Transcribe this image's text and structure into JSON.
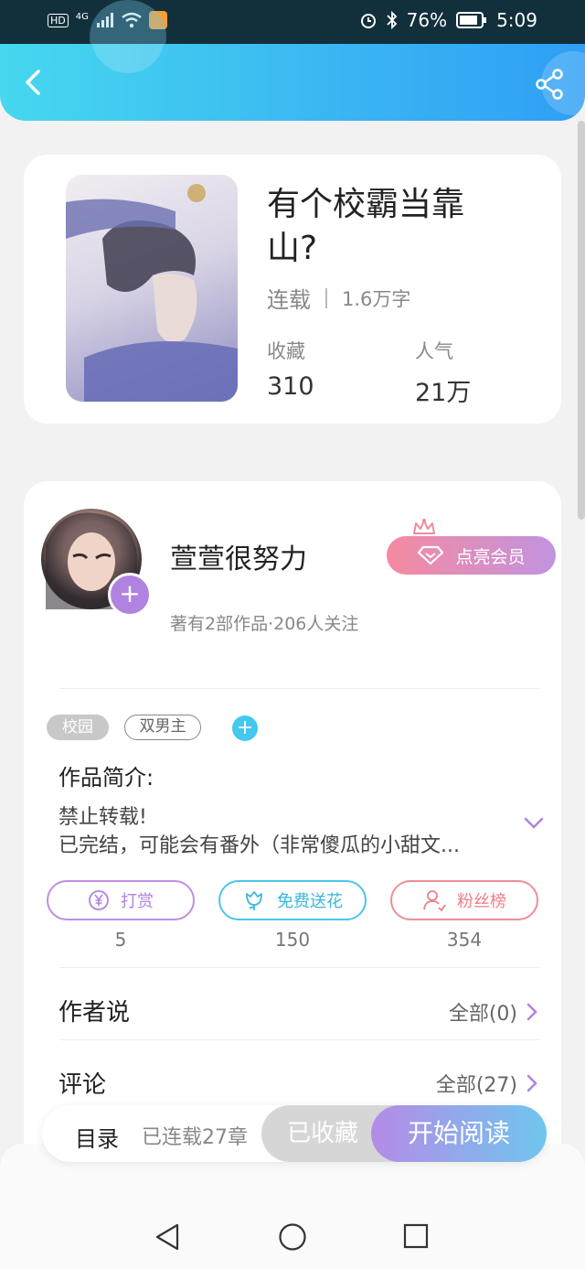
{
  "status_bar": {
    "hd": "HD",
    "signal": "4G",
    "battery": "76%",
    "time": "5:09"
  },
  "book": {
    "title": "有个校霸当靠山?",
    "status": "连载",
    "word_count": "1.6万字",
    "favorites_label": "收藏",
    "favorites_value": "310",
    "popularity_label": "人气",
    "popularity_value": "21万"
  },
  "author": {
    "name": "萱萱很努力",
    "subtitle": "著有2部作品·206人关注",
    "vip_button": "点亮会员"
  },
  "tags": [
    "校园",
    "双男主"
  ],
  "intro": {
    "title": "作品简介:",
    "lines": [
      "禁止转载!",
      "已完结，可能会有番外（非常傻瓜的小甜文..."
    ]
  },
  "actions": [
    {
      "label": "打赏",
      "count": "5",
      "icon": "yuan-coin-icon"
    },
    {
      "label": "免费送花",
      "count": "150",
      "icon": "flower-icon"
    },
    {
      "label": "粉丝榜",
      "count": "354",
      "icon": "user-icon"
    }
  ],
  "rows": {
    "author_says_label": "作者说",
    "author_says_right": "全部(0)",
    "comments_label": "评论",
    "comments_right": "全部(27)"
  },
  "bottom_bar": {
    "toc_label": "目录",
    "chapters": "已连载27章",
    "favorited": "已收藏",
    "start_reading": "开始阅读"
  },
  "colors": {
    "header_gradient_start": "#46d8ef",
    "header_gradient_end": "#2f9ff5",
    "accent_purple": "#b083e0",
    "accent_cyan": "#43c8ee",
    "accent_pink": "#ec7f88"
  }
}
